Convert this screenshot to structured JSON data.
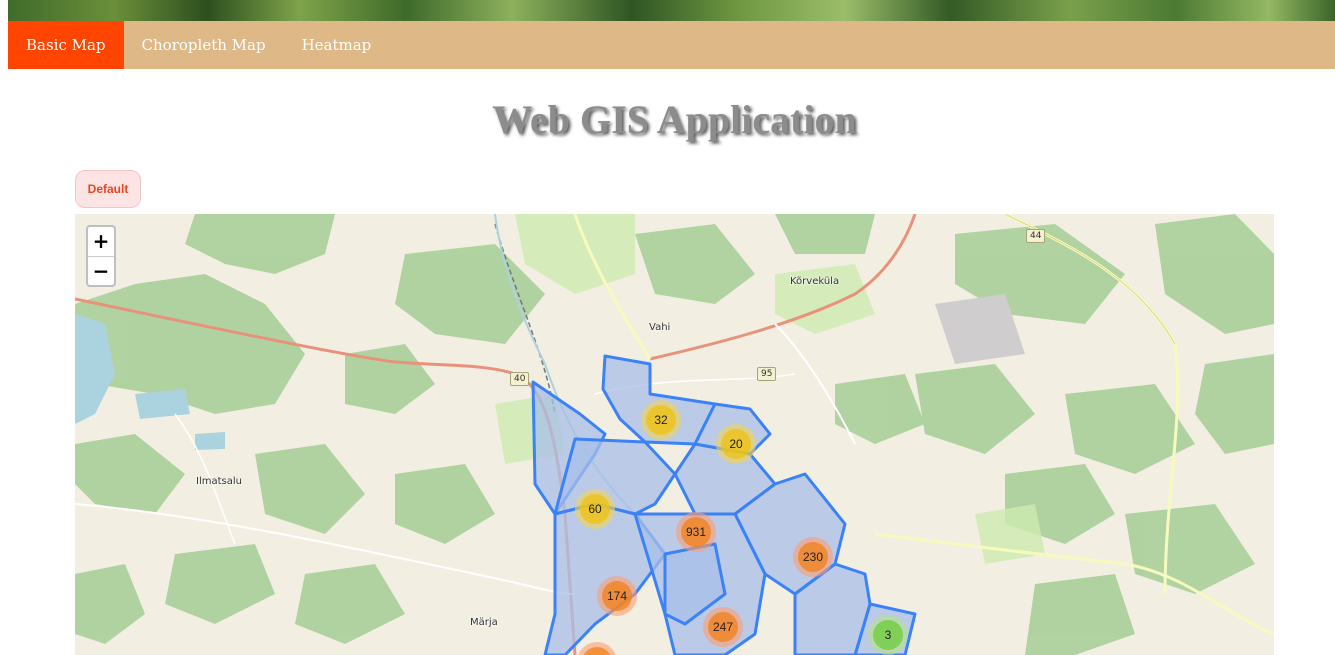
{
  "nav": {
    "items": [
      {
        "label": "Basic Map",
        "active": true
      },
      {
        "label": "Choropleth Map",
        "active": false
      },
      {
        "label": "Heatmap",
        "active": false
      }
    ]
  },
  "page": {
    "title": "Web GIS Application"
  },
  "filter": {
    "default_label": "Default"
  },
  "map": {
    "zoom_in": "+",
    "zoom_out": "−",
    "places": [
      "Kõrveküla",
      "Vahi",
      "Ilmatsalu",
      "Märja"
    ],
    "road_numbers": [
      "44",
      "40",
      "95"
    ],
    "clusters": [
      {
        "count": "32",
        "size": "medium"
      },
      {
        "count": "20",
        "size": "medium"
      },
      {
        "count": "60",
        "size": "medium"
      },
      {
        "count": "931",
        "size": "large"
      },
      {
        "count": "230",
        "size": "large"
      },
      {
        "count": "174",
        "size": "large"
      },
      {
        "count": "247",
        "size": "large"
      },
      {
        "count": "3",
        "size": "small"
      }
    ]
  },
  "colors": {
    "nav_bg": "#deb887",
    "nav_active": "#ff4500",
    "district_stroke": "#3b82f6",
    "district_fill": "#a8bfe8"
  }
}
